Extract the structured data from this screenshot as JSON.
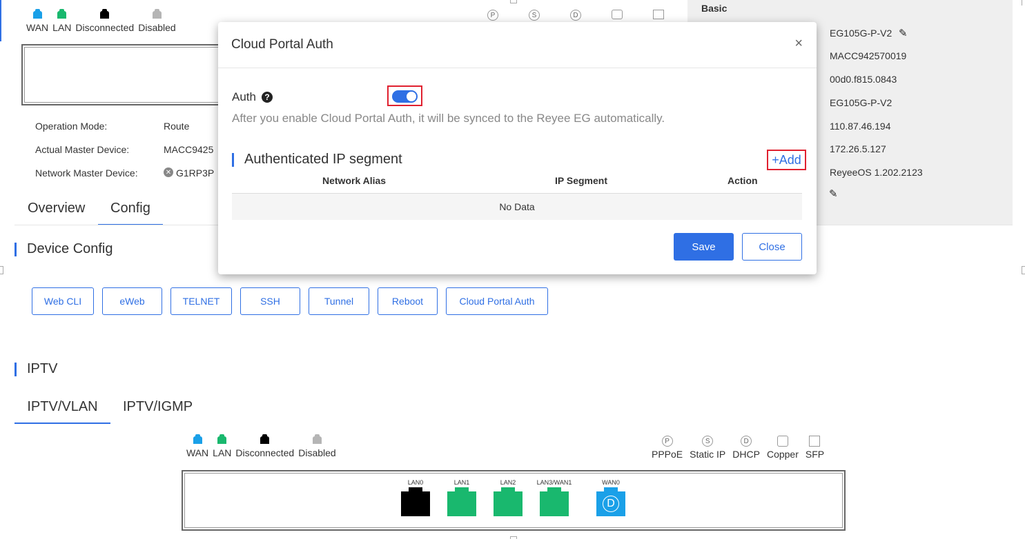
{
  "top_legend": {
    "items": [
      {
        "label": "WAN",
        "color": "#1aa0e8"
      },
      {
        "label": "LAN",
        "color": "#19b86e"
      },
      {
        "label": "Disconnected",
        "color": "#000000"
      },
      {
        "label": "Disabled",
        "color": "#b5b5b5"
      }
    ]
  },
  "device_info": {
    "operation_mode_label": "Operation Mode:",
    "operation_mode_value": "Route",
    "actual_master_label": "Actual Master Device:",
    "actual_master_value": "MACC9425",
    "network_master_label": "Network Master Device:",
    "network_master_value": "G1RP3P"
  },
  "tabs": {
    "overview": "Overview",
    "config": "Config"
  },
  "device_config": {
    "title": "Device Config",
    "buttons": [
      "Web CLI",
      "eWeb",
      "TELNET",
      "SSH",
      "Tunnel",
      "Reboot",
      "Cloud Portal Auth"
    ]
  },
  "iptv": {
    "title": "IPTV",
    "tabs": [
      "IPTV/VLAN",
      "IPTV/IGMP"
    ]
  },
  "bottom_legend": {
    "items": [
      {
        "label": "WAN",
        "color": "#1aa0e8"
      },
      {
        "label": "LAN",
        "color": "#19b86e"
      },
      {
        "label": "Disconnected",
        "color": "#000000"
      },
      {
        "label": "Disabled",
        "color": "#b5b5b5"
      }
    ],
    "port_types": [
      {
        "label": "PPPoE",
        "glyph": "P"
      },
      {
        "label": "Static IP",
        "glyph": "S"
      },
      {
        "label": "DHCP",
        "glyph": "D"
      },
      {
        "label": "Copper",
        "glyph": ""
      },
      {
        "label": "SFP",
        "glyph": ""
      }
    ]
  },
  "top_port_glyphs": [
    "P",
    "S",
    "D",
    "",
    ""
  ],
  "ports": [
    {
      "label": "LAN0",
      "status": "Disconnected",
      "color": "#000000"
    },
    {
      "label": "LAN1",
      "status": "LAN",
      "color": "#19b86e"
    },
    {
      "label": "LAN2",
      "status": "LAN",
      "color": "#19b86e"
    },
    {
      "label": "LAN3/WAN1",
      "status": "LAN",
      "color": "#19b86e"
    },
    {
      "label": "WAN0",
      "status": "WAN",
      "color": "#1aa0e8",
      "glyph": "D"
    }
  ],
  "basic_panel": {
    "title": "Basic",
    "values": [
      "EG105G-P-V2",
      "MACC942570019",
      "00d0.f815.0843",
      "EG105G-P-V2",
      "110.87.46.194",
      "172.26.5.127",
      "ReyeeOS 1.202.2123"
    ]
  },
  "modal": {
    "title": "Cloud Portal Auth",
    "close_glyph": "×",
    "auth_label": "Auth",
    "help_glyph": "?",
    "auth_enabled": true,
    "description": "After you enable Cloud Portal Auth, it will be synced to the Reyee EG automatically.",
    "segment_title": "Authenticated IP segment",
    "add_label": "+Add",
    "columns": [
      "Network Alias",
      "IP Segment",
      "Action"
    ],
    "empty_text": "No Data",
    "save_label": "Save",
    "close_label": "Close"
  },
  "colors": {
    "accent": "#2f6fe4",
    "highlight": "#e0202f"
  }
}
